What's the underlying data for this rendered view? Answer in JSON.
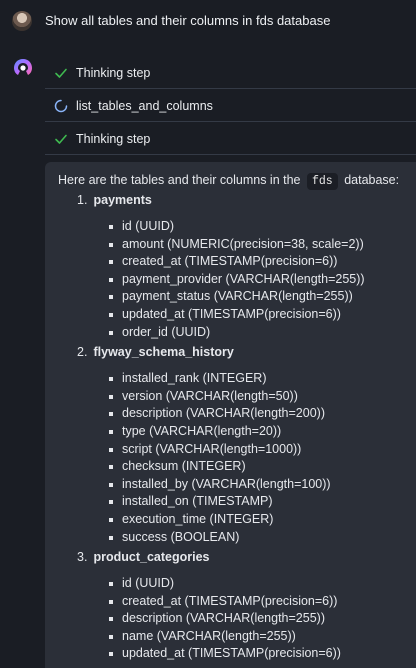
{
  "user": {
    "message": "Show all tables and their columns in fds database"
  },
  "steps": [
    {
      "label": "Thinking step",
      "status": "done"
    },
    {
      "label": "list_tables_and_columns",
      "status": "running"
    },
    {
      "label": "Thinking step",
      "status": "done"
    }
  ],
  "answer": {
    "intro_prefix": "Here are the tables and their columns in the",
    "db_name": "fds",
    "intro_suffix": "database:",
    "tables": [
      {
        "num": "1.",
        "name": "payments",
        "columns": [
          "id (UUID)",
          "amount (NUMERIC(precision=38, scale=2))",
          "created_at (TIMESTAMP(precision=6))",
          "payment_provider (VARCHAR(length=255))",
          "payment_status (VARCHAR(length=255))",
          "updated_at (TIMESTAMP(precision=6))",
          "order_id (UUID)"
        ]
      },
      {
        "num": "2.",
        "name": "flyway_schema_history",
        "columns": [
          "installed_rank (INTEGER)",
          "version (VARCHAR(length=50))",
          "description (VARCHAR(length=200))",
          "type (VARCHAR(length=20))",
          "script (VARCHAR(length=1000))",
          "checksum (INTEGER)",
          "installed_by (VARCHAR(length=100))",
          "installed_on (TIMESTAMP)",
          "execution_time (INTEGER)",
          "success (BOOLEAN)"
        ]
      },
      {
        "num": "3.",
        "name": "product_categories",
        "columns": [
          "id (UUID)",
          "created_at (TIMESTAMP(precision=6))",
          "description (VARCHAR(length=255))",
          "name (VARCHAR(length=255))",
          "updated_at (TIMESTAMP(precision=6))"
        ]
      }
    ]
  },
  "colors": {
    "background": "#1a1d24",
    "panel": "#2b2f38",
    "success": "#3fb950",
    "spinner": "#8ab4f8"
  }
}
